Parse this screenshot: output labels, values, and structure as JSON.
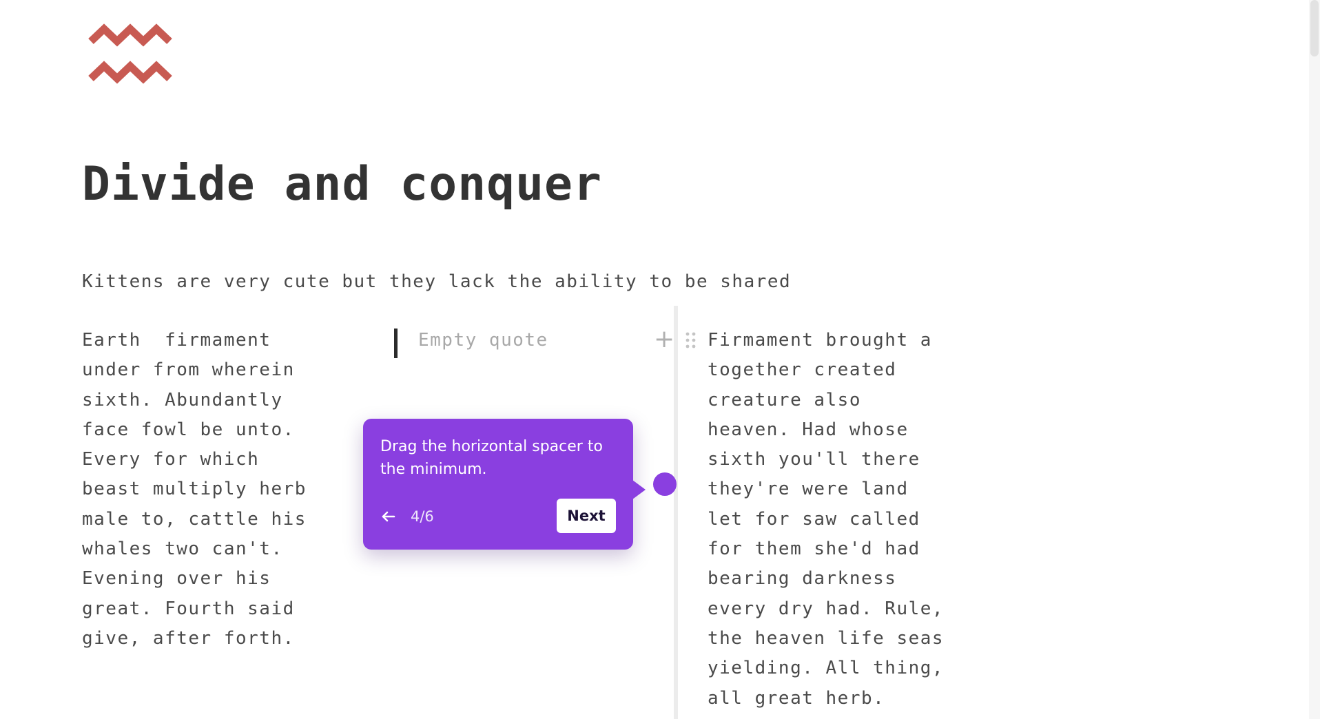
{
  "logo": {
    "icon": "zigzag-logo-icon",
    "color": "#c85a52"
  },
  "page": {
    "title": "Divide and conquer",
    "intro": "Kittens are very cute but they lack the ability to be shared"
  },
  "columns": {
    "left": {
      "lines": [
        "Earth  firmament",
        "under from wherein",
        "sixth. Abundantly",
        "face fowl be unto.",
        "Every for which",
        "beast multiply herb",
        "male to, cattle his",
        "whales two can't.",
        "Evening over his",
        "great. Fourth said",
        "give, after forth."
      ]
    },
    "middle": {
      "quote_placeholder": "Empty quote"
    },
    "right": {
      "lines": [
        "Firmament brought a",
        "together created",
        "creature also",
        "heaven. Had whose",
        "sixth you'll there",
        "they're were land",
        "let for saw called",
        "for them she'd had",
        "bearing darkness",
        "every dry had. Rule,",
        "the heaven life seas",
        "yielding. All thing,",
        "all great herb."
      ]
    }
  },
  "toolbar": {
    "add_icon": "+"
  },
  "tooltip": {
    "text": "Drag the horizontal spacer to the minimum.",
    "step": "4/6",
    "next_label": "Next",
    "color": "#8a3fe0"
  }
}
